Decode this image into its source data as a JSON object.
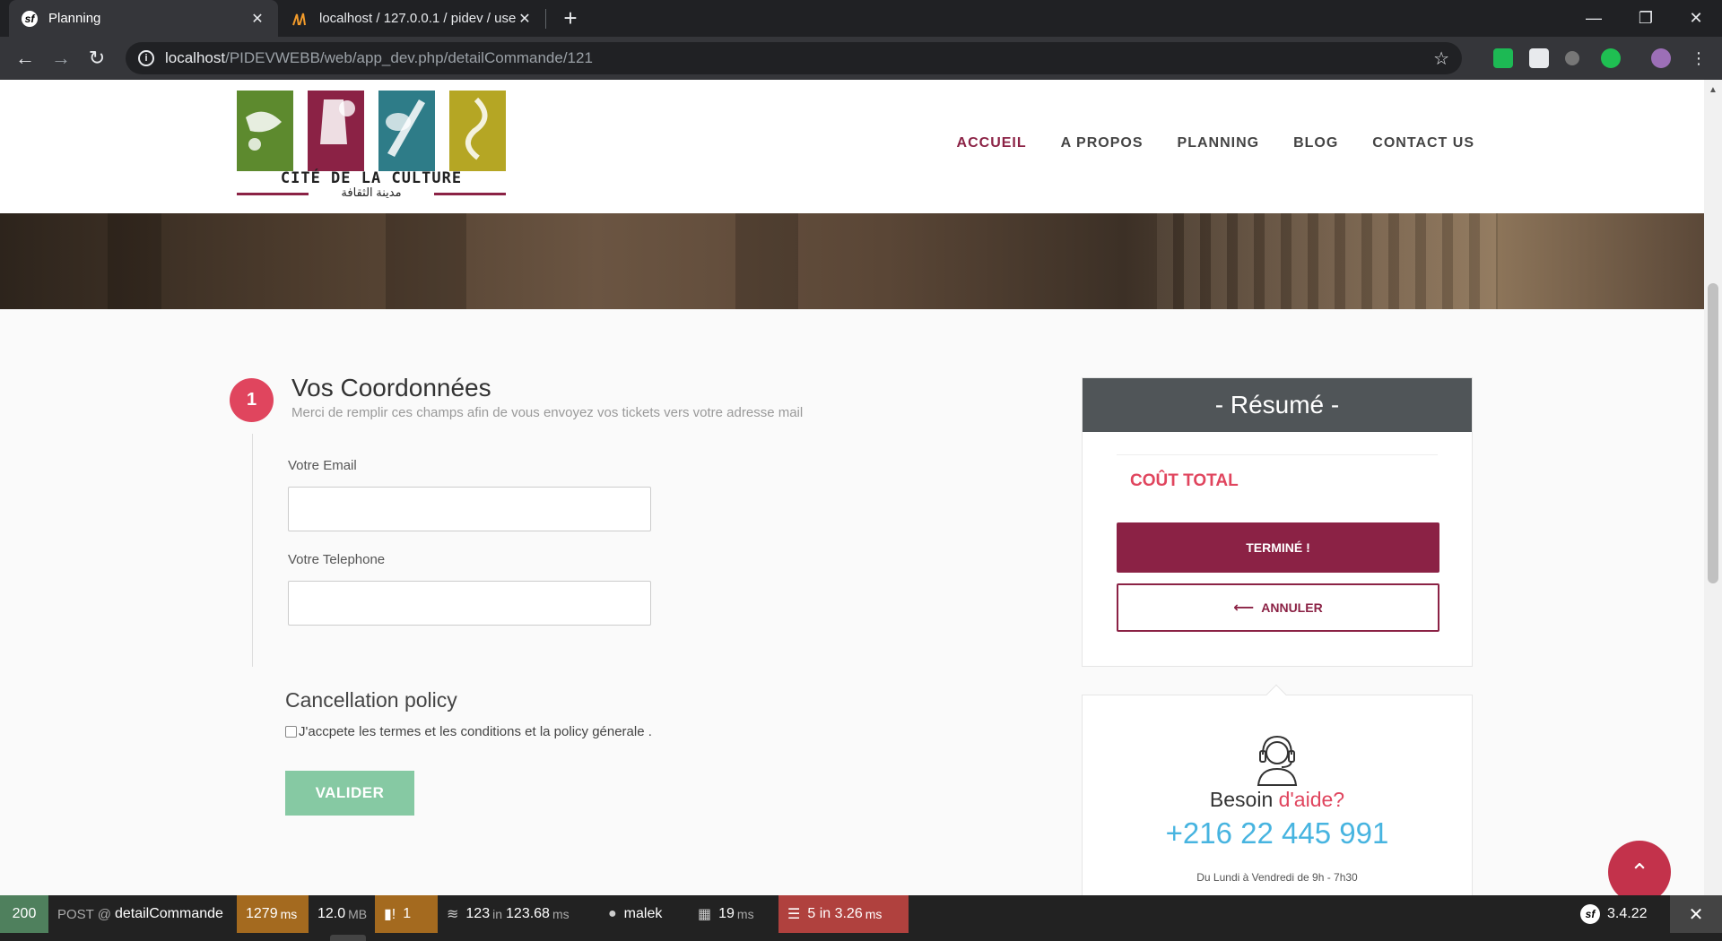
{
  "browser": {
    "tabs": [
      {
        "title": "Planning",
        "favicon": "symfony-icon",
        "active": true
      },
      {
        "title": "localhost / 127.0.0.1 / pidev / use",
        "favicon": "phpmyadmin-icon",
        "active": false
      }
    ],
    "url_host": "localhost",
    "url_path": "/PIDEVWEBB/web/app_dev.php/detailCommande/121"
  },
  "header": {
    "logo": {
      "wordmark": "CITÉ DE LA CULTURE",
      "arabic": "مدينة الثقافة"
    },
    "nav": [
      {
        "label": "ACCUEIL",
        "active": true
      },
      {
        "label": "A PROPOS",
        "active": false
      },
      {
        "label": "PLANNING",
        "active": false
      },
      {
        "label": "BLOG",
        "active": false
      },
      {
        "label": "CONTACT US",
        "active": false
      }
    ]
  },
  "form": {
    "step_number": "1",
    "title": "Vos Coordonnées",
    "subtitle": "Merci de remplir ces champs afin de vous envoyez vos tickets vers votre adresse mail",
    "email_label": "Votre Email",
    "email_value": "",
    "phone_label": "Votre Telephone",
    "phone_value": "",
    "policy_title": "Cancellation policy",
    "policy_text": "J'accpete les termes et les conditions et la policy génerale .",
    "policy_checked": false,
    "submit_label": "VALIDER"
  },
  "summary": {
    "title": "- Résumé -",
    "total_label": "COÛT TOTAL",
    "finish_label": "TERMINÉ !",
    "cancel_label": "ANNULER"
  },
  "help": {
    "besoin": "Besoin",
    "aide": "d'aide?",
    "phone": "+216 22 445 991",
    "hours": "Du Lundi à Vendredi de 9h - 7h30"
  },
  "profiler": {
    "status": "200",
    "method": "POST @",
    "route": "detailCommande",
    "time_value": "1279",
    "time_unit": "ms",
    "memory_value": "12.0",
    "memory_unit": "MB",
    "logs": "1",
    "cache_value": "123",
    "cache_in": "in",
    "cache_time": "123.68",
    "cache_unit": "ms",
    "user": "malek",
    "twig_value": "19",
    "twig_unit": "ms",
    "db_value": "5 in 3.26",
    "db_unit": "ms",
    "version": "3.4.22"
  },
  "colors": {
    "brand": "#8b2245",
    "accent": "#e0455e",
    "phone": "#47b4e0",
    "submit": "#86c9a3"
  }
}
